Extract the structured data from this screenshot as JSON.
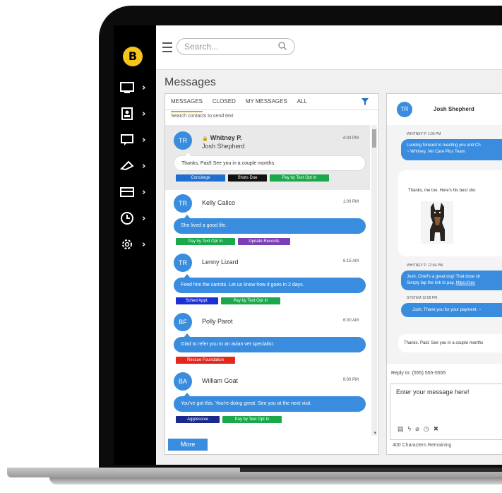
{
  "app": {
    "logo_letter": "B"
  },
  "sidebar": {
    "items": [
      {
        "icon": "monitor-icon"
      },
      {
        "icon": "contact-card-icon"
      },
      {
        "icon": "chat-icon"
      },
      {
        "icon": "megaphone-icon"
      },
      {
        "icon": "card-icon"
      },
      {
        "icon": "clock-icon"
      },
      {
        "icon": "gear-icon"
      }
    ],
    "chevron": "›"
  },
  "topbar": {
    "search_placeholder": "Search..."
  },
  "page_title": "Messages",
  "list": {
    "tabs": [
      "MESSAGES",
      "CLOSED",
      "MY MESSAGES",
      "ALL"
    ],
    "active_tab": "MESSAGES",
    "search_label": "Search contacts to send text",
    "more_label": "More",
    "conversations": [
      {
        "initials": "TR",
        "name": "Whitney P.",
        "subname": "Josh Shepherd",
        "time": "4:00 PM",
        "message": "Thanks, Paid! See you in a couple months.",
        "tags": [
          {
            "label": "Concierge",
            "color": "#1f6fd1"
          },
          {
            "label": "Shots Due",
            "color": "#111111"
          },
          {
            "label": "Pay by Text Opt In",
            "color": "#1aa84a"
          }
        ]
      },
      {
        "initials": "TR",
        "name": "Kelly Calico",
        "time": "1:00 PM",
        "message": "She lived a good life.",
        "tags": [
          {
            "label": "Pay by Text Opt In",
            "color": "#1aa84a"
          },
          {
            "label": "Update Records",
            "color": "#7b3fb5"
          }
        ]
      },
      {
        "initials": "TR",
        "name": "Lenny Lizard",
        "time": "6:15 AM",
        "message": "Feed him the carrots. Let us know how it goes in 2 days.",
        "tags": [
          {
            "label": "Sched Appt.",
            "color": "#1b2fd6"
          },
          {
            "label": "Pay by Text Opt In",
            "color": "#1aa84a"
          }
        ]
      },
      {
        "initials": "BF",
        "name": "Polly Parot",
        "time": "6:00 AM",
        "message": "Glad to refer you to an avian vet specialist.",
        "tags": [
          {
            "label": "Rescue Foundation",
            "color": "#e5261b"
          }
        ]
      },
      {
        "initials": "BA",
        "name": "William Goat",
        "time": "9:00 PM",
        "message": "You've got this. You're doing great. See you at the next visit.",
        "tags": [
          {
            "label": "Aggressive",
            "color": "#1a2a8a"
          },
          {
            "label": "Pay by Text Opt In",
            "color": "#1aa84a"
          }
        ]
      }
    ]
  },
  "chat": {
    "initials": "TR",
    "contact_name": "Josh Shepherd",
    "messages": [
      {
        "meta": "WHITNEY P. 1:00 PM",
        "line1": "Looking forward to meeting you and Ch",
        "line2": "~ Whitney, Vet Care Plus Team"
      },
      {
        "text": "Thanks, me too. Here's his best sho"
      },
      {
        "meta": "WHITNEY P. 12:04 PM",
        "line1": "Josh, Chief's a great dog! That dose sh",
        "line2_prefix": "Simply tap the link to pay. ",
        "line2_link": "https://sec"
      },
      {
        "meta": "SYSTEM 12:08 PM",
        "line1": "Josh, Thank you for your payment. ~"
      },
      {
        "text": "Thanks. Paid. See you in a couple months"
      }
    ],
    "reply_to": "Reply to: (555) 555-5555",
    "compose_placeholder": "Enter your message here!",
    "chars_remaining": "400 Characters Remaining",
    "tool_icons": [
      "document-icon",
      "lightning-icon",
      "paperclip-icon",
      "clock-icon",
      "close-icon"
    ]
  }
}
